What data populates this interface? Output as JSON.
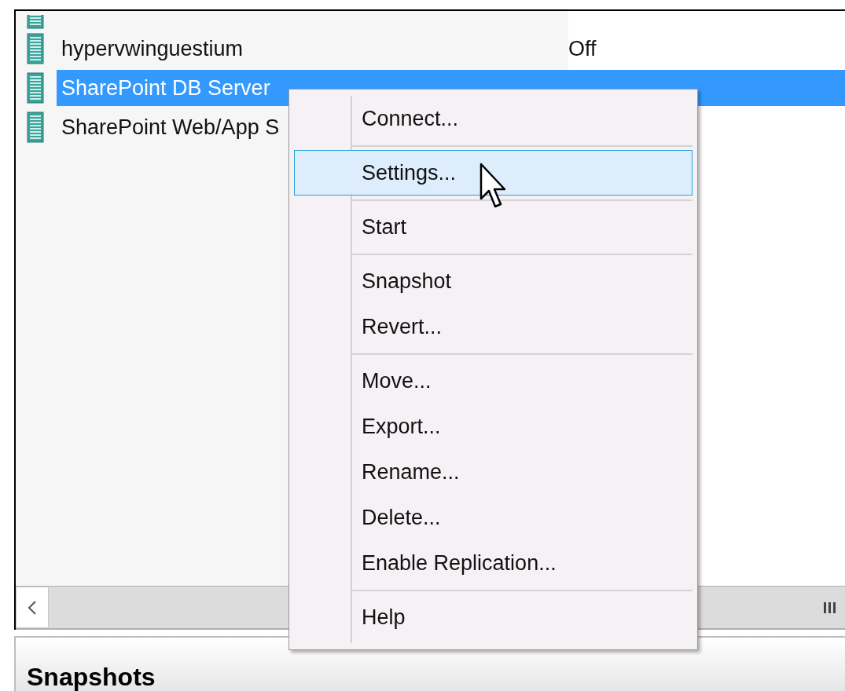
{
  "vm_list": {
    "rows": [
      {
        "name": "hypervwinguestium",
        "state": "Off",
        "selected": false
      },
      {
        "name": "SharePoint DB Server",
        "selected": true
      },
      {
        "name": "SharePoint Web/App S",
        "selected": false
      }
    ]
  },
  "context_menu": {
    "items": [
      {
        "kind": "item",
        "label": "Connect...",
        "selected": false
      },
      {
        "kind": "separator"
      },
      {
        "kind": "item",
        "label": "Settings...",
        "selected": true
      },
      {
        "kind": "separator"
      },
      {
        "kind": "item",
        "label": "Start",
        "selected": false
      },
      {
        "kind": "separator"
      },
      {
        "kind": "item",
        "label": "Snapshot",
        "selected": false
      },
      {
        "kind": "item",
        "label": "Revert...",
        "selected": false
      },
      {
        "kind": "separator"
      },
      {
        "kind": "item",
        "label": "Move...",
        "selected": false
      },
      {
        "kind": "item",
        "label": "Export...",
        "selected": false
      },
      {
        "kind": "item",
        "label": "Rename...",
        "selected": false
      },
      {
        "kind": "item",
        "label": "Delete...",
        "selected": false
      },
      {
        "kind": "item",
        "label": "Enable Replication...",
        "selected": false
      },
      {
        "kind": "separator"
      },
      {
        "kind": "item",
        "label": "Help",
        "selected": false
      }
    ]
  },
  "snapshots_panel": {
    "title": "Snapshots"
  }
}
